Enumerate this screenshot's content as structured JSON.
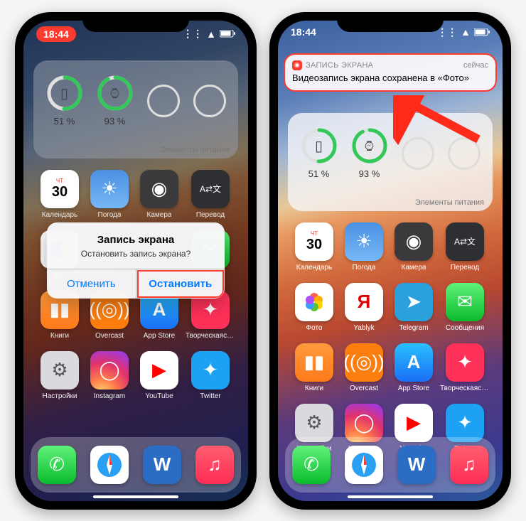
{
  "status": {
    "time": "18:44",
    "signal": "●●●●",
    "wifi": "wifi",
    "battery": "batt"
  },
  "widget": {
    "label": "Элементы питания",
    "dev1_pct": "51 %",
    "dev2_pct": "93 %"
  },
  "apps": {
    "cal_day": "ЧТ",
    "cal_num": "30",
    "cal": "Календарь",
    "weather": "Погода",
    "camera": "Камера",
    "translate": "Перевод",
    "photos": "Фото",
    "yablyk": "Yablyk",
    "telegram": "Telegram",
    "messages": "Сообщения",
    "books": "Книги",
    "overcast": "Overcast",
    "appstore": "App Store",
    "shortcuts": "Творческаясту...",
    "settings": "Настройки",
    "instagram": "Instagram",
    "youtube": "YouTube",
    "twitter": "Twitter"
  },
  "apps_left": {
    "photos": "Фот",
    "messages": "щения"
  },
  "alert": {
    "title": "Запись экрана",
    "message": "Остановить запись экрана?",
    "cancel": "Отменить",
    "stop": "Остановить"
  },
  "notif": {
    "app": "ЗАПИСЬ ЭКРАНА",
    "when": "сейчас",
    "body": "Видеозапись экрана сохранена в «Фото»"
  }
}
